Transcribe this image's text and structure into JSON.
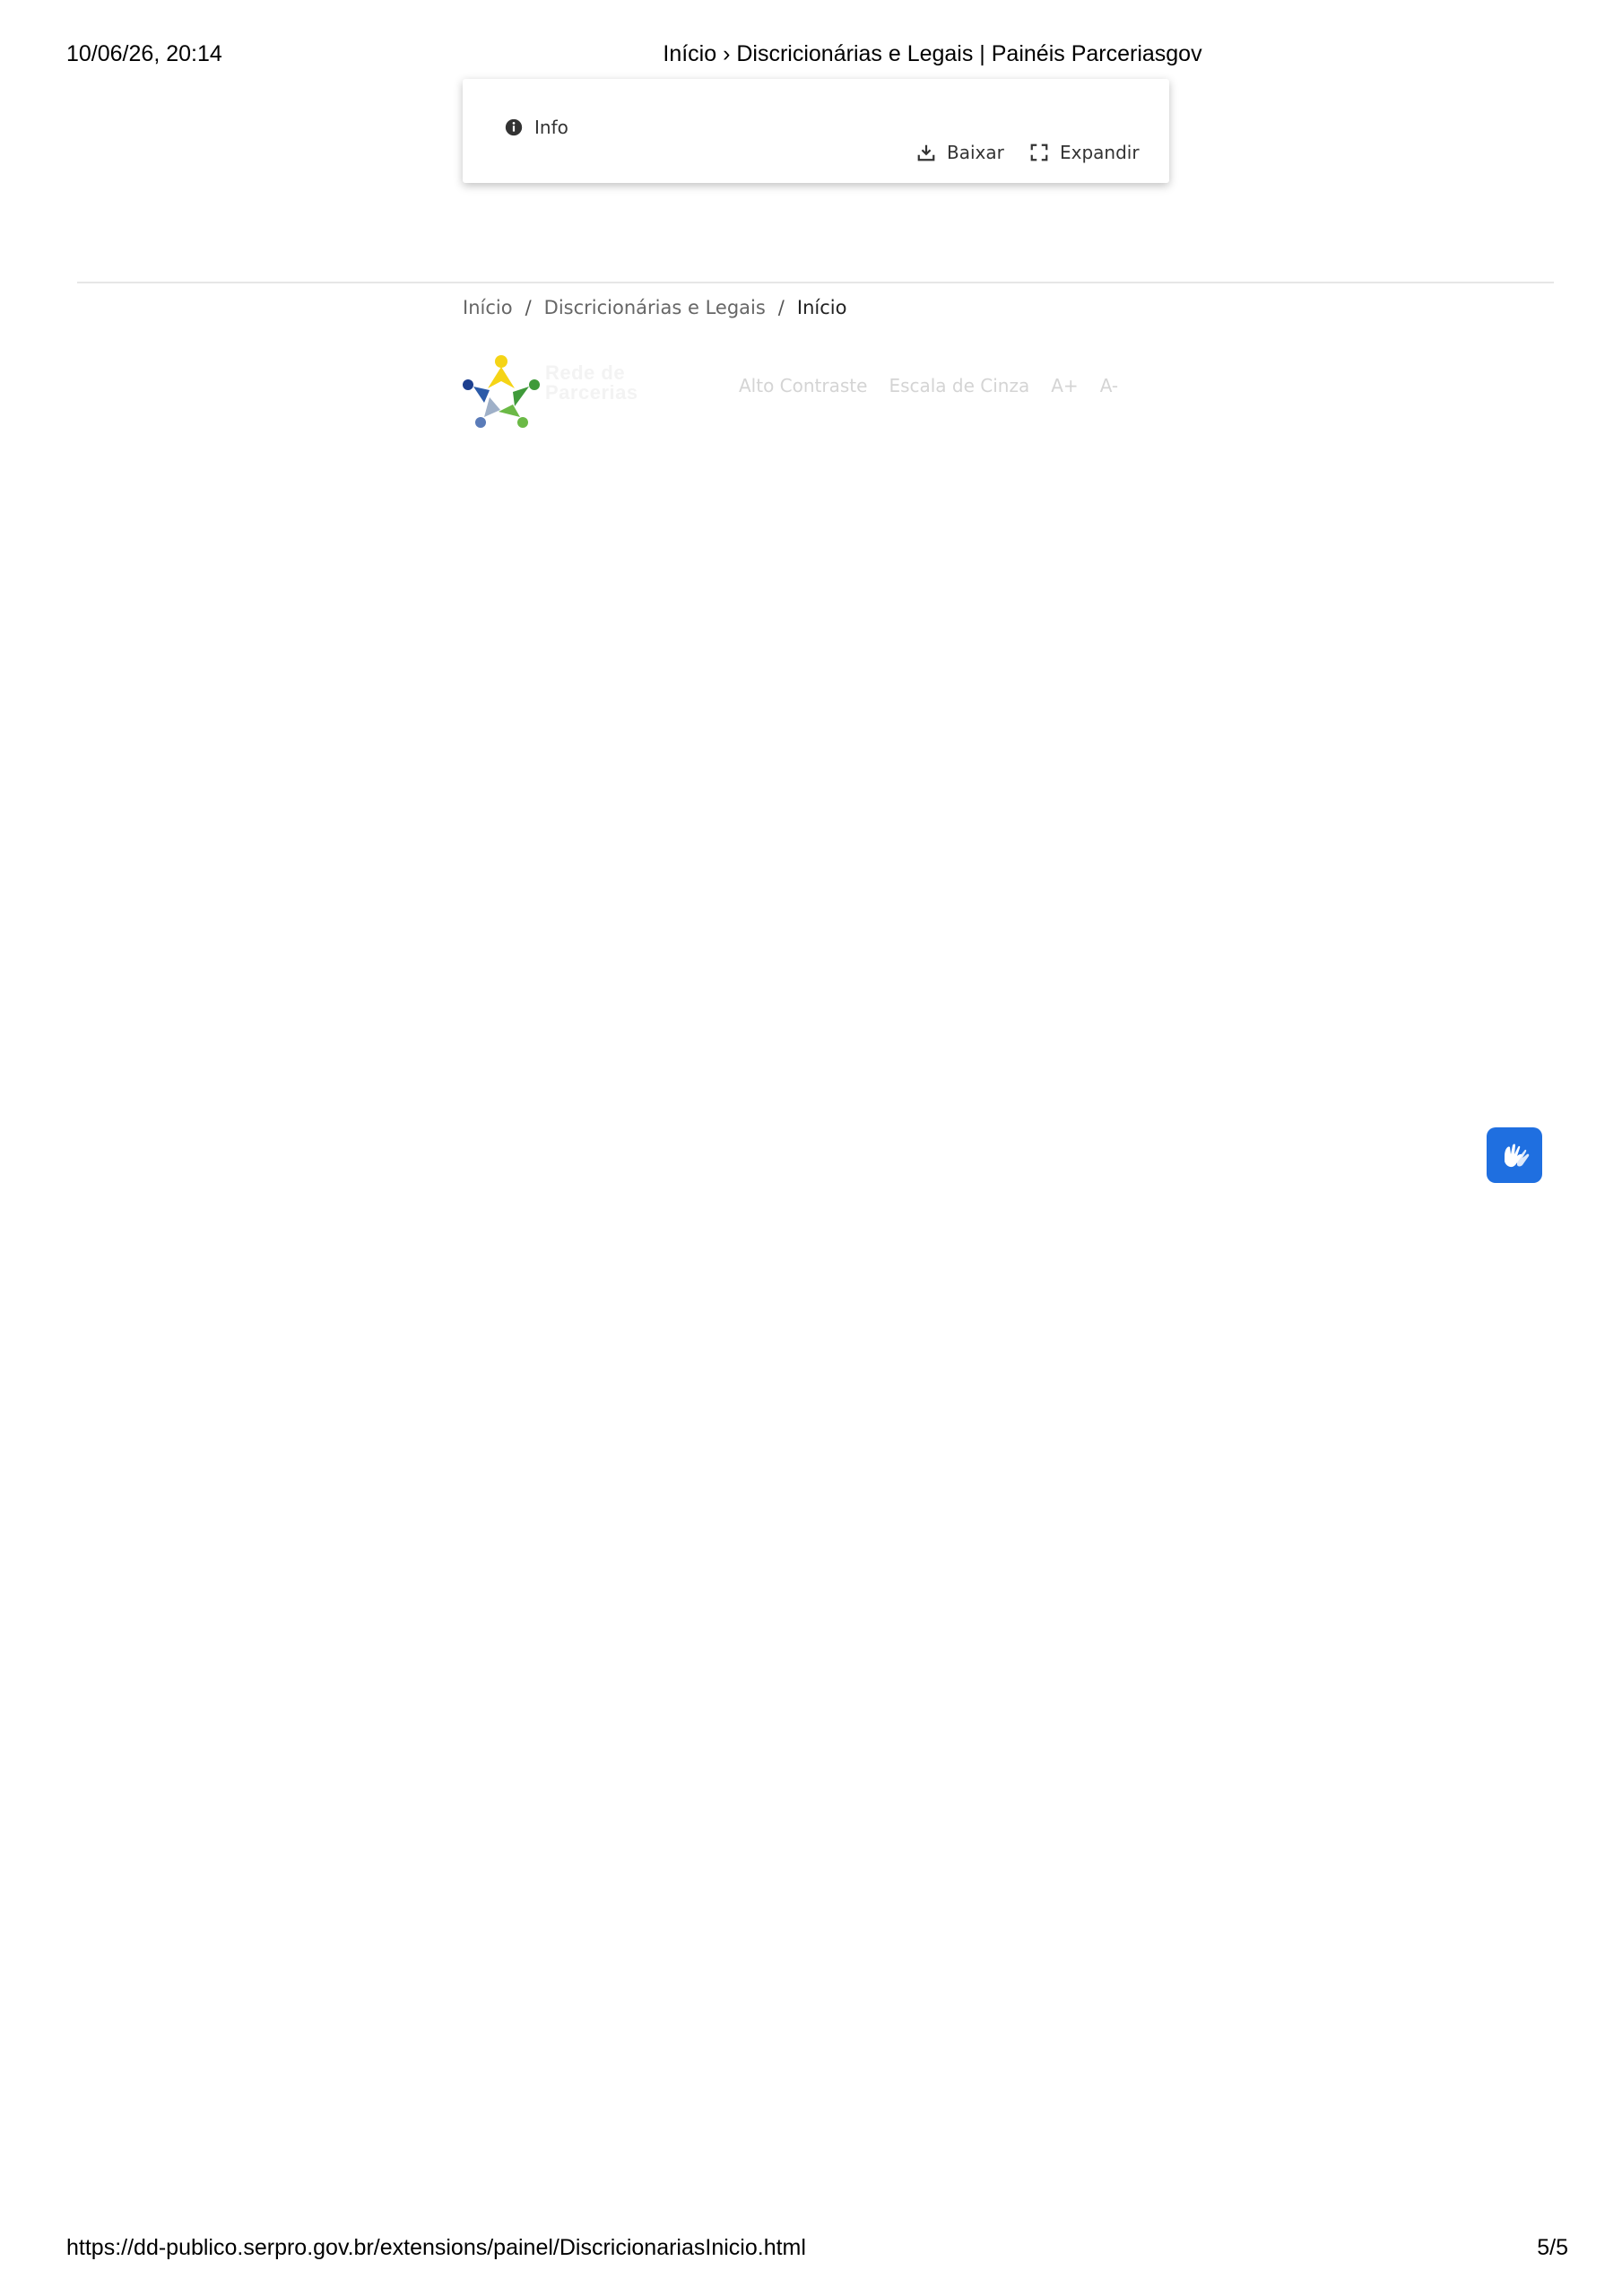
{
  "print_header": {
    "datetime": "10/06/26, 20:14",
    "title": "Início › Discricionárias e Legais | Painéis Parceriasgov"
  },
  "card": {
    "info_label": "Info",
    "download_label": "Baixar",
    "expand_label": "Expandir"
  },
  "breadcrumb": {
    "items": [
      "Início",
      "Discricionárias e Legais",
      "Início"
    ],
    "separator": "/"
  },
  "logo": {
    "text_line1": "Rede de",
    "text_line2": "Parcerias",
    "colors": [
      "#f5d416",
      "#3f9a3a",
      "#2b5aa8",
      "#6bb946",
      "#1d3f8f"
    ]
  },
  "accessibility": {
    "high_contrast": "Alto Contraste",
    "grayscale": "Escala de Cinza",
    "font_increase": "A+",
    "font_decrease": "A-"
  },
  "vlibras": {
    "icon": "hands-sign-language-icon",
    "color": "#1f6fe0"
  },
  "print_footer": {
    "url": "https://dd-publico.serpro.gov.br/extensions/painel/DiscricionariasInicio.html",
    "page": "5/5"
  }
}
